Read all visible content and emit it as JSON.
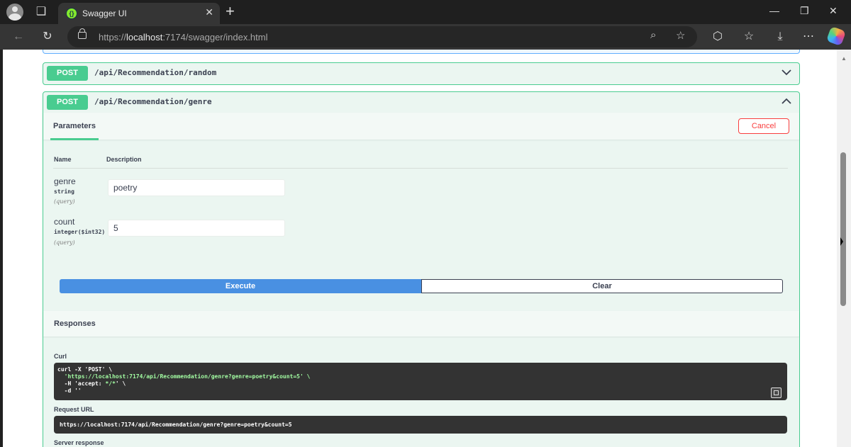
{
  "browser": {
    "tab_title": "Swagger UI",
    "favicon_glyph": "{}",
    "url_scheme": "https://",
    "url_host": "localhost",
    "url_rest": ":7174/swagger/index.html",
    "icons": [
      "profile-icon",
      "workspaces-icon",
      "close-icon",
      "new-tab-icon",
      "minimize-icon",
      "maximize-icon",
      "window-close-icon",
      "back-icon",
      "refresh-icon",
      "lock-icon",
      "zoom-icon",
      "favorite-icon",
      "extensions-icon",
      "favorites-icon",
      "downloads-icon",
      "more-icon",
      "copilot-icon"
    ]
  },
  "swagger": {
    "colors": {
      "post": "#49cc90",
      "get": "#61affe",
      "execute": "#4990e2",
      "cancel": "#f93e3e"
    },
    "op_random": {
      "method": "POST",
      "path": "/api/Recommendation/random"
    },
    "op_genre": {
      "method": "POST",
      "path": "/api/Recommendation/genre",
      "params_tab": "Parameters",
      "cancel_label": "Cancel",
      "col_name": "Name",
      "col_description": "Description",
      "parameters": [
        {
          "name": "genre",
          "type": "string",
          "in": "(query)",
          "value": "poetry"
        },
        {
          "name": "count",
          "type": "integer($int32)",
          "in": "(query)",
          "value": "5"
        }
      ],
      "execute_label": "Execute",
      "clear_label": "Clear",
      "responses_title": "Responses",
      "curl_label": "Curl",
      "curl_line1": "curl -X 'POST' \\",
      "curl_line2": "  'https://localhost:7174/api/Recommendation/genre?genre=poetry&count=5' \\",
      "curl_line3a": "  -H 'accept: ",
      "curl_line3b": "*/*",
      "curl_line3c": "' \\",
      "curl_line4": "  -d ''",
      "request_url_label": "Request URL",
      "request_url": "https://localhost:7174/api/Recommendation/genre?genre=poetry&count=5",
      "server_response_label": "Server response"
    }
  }
}
